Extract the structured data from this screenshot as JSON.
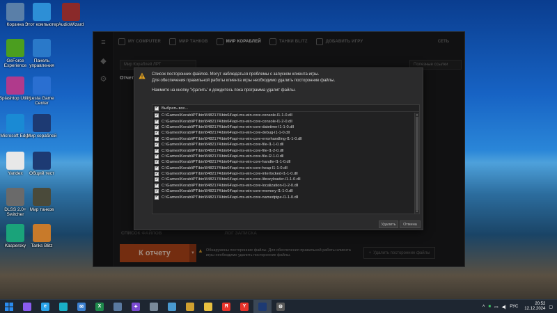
{
  "desktop": {
    "icons": [
      {
        "label": "Корзина",
        "icon": "recycle-bin-icon",
        "color": "#5a7fa8"
      },
      {
        "label": "Этот компьютер",
        "icon": "this-pc-icon",
        "color": "#2d8fd6"
      },
      {
        "label": "AudioWizard",
        "icon": "audio-wizard-icon",
        "color": "#8a2a2a"
      },
      {
        "label": "GeForce Experience",
        "icon": "geforce-icon",
        "color": "#4b9e1f"
      },
      {
        "label": "Панель управления",
        "icon": "control-panel-icon",
        "color": "#2a79c9"
      },
      {
        "label": "Splashtop Utility",
        "icon": "splashtop-icon",
        "color": "#b03a8c"
      },
      {
        "label": "Lesta Game Center",
        "icon": "lesta-icon",
        "color": "#2a6fd1"
      },
      {
        "label": "Microsoft Edge",
        "icon": "edge-icon",
        "color": "#1a8ad4"
      },
      {
        "label": "Мир кораблей",
        "icon": "mir-korabley-icon",
        "color": "#1d3a73"
      },
      {
        "label": "Yandex",
        "icon": "yandex-icon",
        "color": "#e8e8e8"
      },
      {
        "label": "Общий тест",
        "icon": "common-test-icon",
        "color": "#1d3a73"
      },
      {
        "label": "DLSS 2.0+ Switcher",
        "icon": "dlss-icon",
        "color": "#6a6a6a"
      },
      {
        "label": "Мир танков",
        "icon": "mir-tankov-icon",
        "color": "#4a4a3a"
      },
      {
        "label": "Kaspersky",
        "icon": "kaspersky-icon",
        "color": "#1aa37a"
      },
      {
        "label": "Tanks Blitz",
        "icon": "tanks-blitz-icon",
        "color": "#c87a2a"
      }
    ]
  },
  "launcher": {
    "nav": [
      {
        "label": "MY COMPUTER",
        "active": false
      },
      {
        "label": "МИР ТАНКОВ",
        "active": false
      },
      {
        "label": "МИР КОРАБЛЕЙ",
        "active": true
      },
      {
        "label": "ТАНКИ BLITZ",
        "active": false
      },
      {
        "label": "ДОБАВИТЬ ИГРУ",
        "active": false
      }
    ],
    "network_label": "СЕТЬ",
    "game_select": "Мир Кораблей ЛРТ",
    "links_select": "Полезные ссылки",
    "report_heading": "Отчет о",
    "bottom_tabs": [
      "СПИСОК ФАЙЛОВ",
      "ЛОГ ЗАПИСКА"
    ],
    "report_button": "К отчету",
    "bottom_warning": "Обнаружены посторонние файлы. Для обеспечения правильной работы клиента игры необходимо удалить посторонние файлы.",
    "bottom_delete": "Удалить посторонние файлы"
  },
  "dialog": {
    "line1": "Список посторонних файлов. Могут наблюдаться проблемы с запуском клиента игры.",
    "line2": "Для обеспечения правильной работы клиента игры необходимо удалить посторонние файлы.",
    "line3": "Нажмите на кнопку 'Удалить' и дождитесь пока программа удалит файлы.",
    "select_all": "Выбрать все...",
    "files": [
      "C:\\Games\\KorabliPT\\bin\\8482174\\bin64\\api-ms-win-core-console-l1-1-0.dll",
      "C:\\Games\\KorabliPT\\bin\\8482174\\bin64\\api-ms-win-core-console-l1-2-0.dll",
      "C:\\Games\\KorabliPT\\bin\\8482174\\bin64\\api-ms-win-core-datetime-l1-1-0.dll",
      "C:\\Games\\KorabliPT\\bin\\8482174\\bin64\\api-ms-win-core-debug-l1-1-0.dll",
      "C:\\Games\\KorabliPT\\bin\\8482174\\bin64\\api-ms-win-core-errorhandling-l1-1-0.dll",
      "C:\\Games\\KorabliPT\\bin\\8482174\\bin64\\api-ms-win-core-file-l1-1-0.dll",
      "C:\\Games\\KorabliPT\\bin\\8482174\\bin64\\api-ms-win-core-file-l1-2-0.dll",
      "C:\\Games\\KorabliPT\\bin\\8482174\\bin64\\api-ms-win-core-file-l2-1-0.dll",
      "C:\\Games\\KorabliPT\\bin\\8482174\\bin64\\api-ms-win-core-handle-l1-1-0.dll",
      "C:\\Games\\KorabliPT\\bin\\8482174\\bin64\\api-ms-win-core-heap-l1-1-0.dll",
      "C:\\Games\\KorabliPT\\bin\\8482174\\bin64\\api-ms-win-core-interlocked-l1-1-0.dll",
      "C:\\Games\\KorabliPT\\bin\\8482174\\bin64\\api-ms-win-core-libraryloader-l1-1-0.dll",
      "C:\\Games\\KorabliPT\\bin\\8482174\\bin64\\api-ms-win-core-localization-l1-2-0.dll",
      "C:\\Games\\KorabliPT\\bin\\8482174\\bin64\\api-ms-win-core-memory-l1-1-0.dll",
      "C:\\Games\\KorabliPT\\bin\\8482174\\bin64\\api-ms-win-core-namedpipe-l1-1-0.dll"
    ],
    "delete_label": "Удалить",
    "cancel_label": "Отмена",
    "warning_color": "#e0a020"
  },
  "taskbar": {
    "items": [
      {
        "icon": "start-icon",
        "glyph": "",
        "color": "#2a8cf0"
      },
      {
        "icon": "alice-icon",
        "glyph": "",
        "color": "#8a5cf0"
      },
      {
        "icon": "ie-icon",
        "glyph": "e",
        "color": "#2aa3e8"
      },
      {
        "icon": "edge-icon",
        "glyph": "",
        "color": "#1ab0c8"
      },
      {
        "icon": "mail-icon",
        "glyph": "✉",
        "color": "#3a7fd0"
      },
      {
        "icon": "excel-icon",
        "glyph": "X",
        "color": "#1f8a4c"
      },
      {
        "icon": "network-app-icon",
        "glyph": "",
        "color": "#5a7aa0"
      },
      {
        "icon": "settings-app-icon",
        "glyph": "✦",
        "color": "#7a4ad0"
      },
      {
        "icon": "printer-icon",
        "glyph": "",
        "color": "#7a8a9a"
      },
      {
        "icon": "monitor-icon",
        "glyph": "",
        "color": "#4a9ad0"
      },
      {
        "icon": "paint-icon",
        "glyph": "",
        "color": "#d0a030"
      },
      {
        "icon": "explorer-icon",
        "glyph": "",
        "color": "#e8c040"
      },
      {
        "icon": "yandex-icon",
        "glyph": "Я",
        "color": "#e8332a"
      },
      {
        "icon": "yandex-browser-icon",
        "glyph": "Y",
        "color": "#e8332a"
      },
      {
        "icon": "mir-korabley-icon",
        "glyph": "",
        "color": "#1d3a73"
      },
      {
        "icon": "gear-app-icon",
        "glyph": "⚙",
        "color": "#5a5a5a"
      }
    ],
    "language": "РУС",
    "time": "20:52",
    "date": "12.12.2024"
  }
}
